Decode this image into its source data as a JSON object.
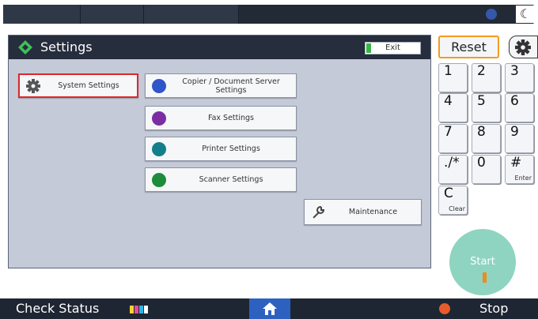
{
  "panel": {
    "title": "Settings",
    "exit_label": "Exit",
    "tiles": [
      {
        "label": "System Settings",
        "icon": "gear-icon"
      },
      {
        "label": "Copier / Document Server Settings",
        "icon": "copier-icon"
      },
      {
        "label": "Fax Settings",
        "icon": "fax-icon"
      },
      {
        "label": "Printer Settings",
        "icon": "printer-icon"
      },
      {
        "label": "Scanner Settings",
        "icon": "scanner-icon"
      },
      {
        "label": "Maintenance",
        "icon": "wrench-icon"
      }
    ]
  },
  "keypad": {
    "reset_label": "Reset",
    "keys": [
      {
        "label": "1",
        "sub": ""
      },
      {
        "label": "2",
        "sub": ""
      },
      {
        "label": "3",
        "sub": ""
      },
      {
        "label": "4",
        "sub": ""
      },
      {
        "label": "5",
        "sub": ""
      },
      {
        "label": "6",
        "sub": ""
      },
      {
        "label": "7",
        "sub": ""
      },
      {
        "label": "8",
        "sub": ""
      },
      {
        "label": "9",
        "sub": ""
      },
      {
        "label": "./*",
        "sub": ""
      },
      {
        "label": "0",
        "sub": ""
      },
      {
        "label": "#",
        "sub": "Enter"
      },
      {
        "label": "C",
        "sub": "Clear"
      }
    ],
    "start_label": "Start"
  },
  "bottom_bar": {
    "check_status_label": "Check Status",
    "stop_label": "Stop"
  },
  "colors": {
    "selection_border": "#e0262b",
    "reset_border": "#f29b1e",
    "home_button": "#2d61c0",
    "start_button": "#8fd4c0"
  }
}
